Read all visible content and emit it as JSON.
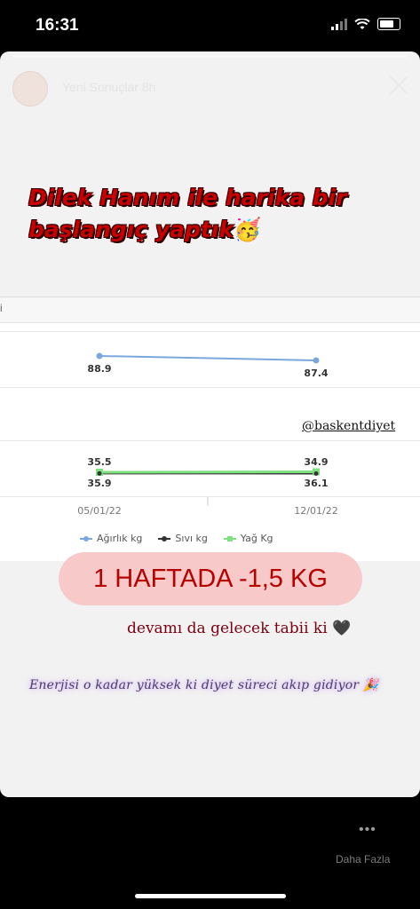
{
  "status_bar": {
    "time": "16:31"
  },
  "story": {
    "username": "Yeni Sonuçlar  8h",
    "headline_line1": "Dilek Hanım ile harika bir",
    "headline_line2": "başlangıç yaptık",
    "headline_emoji": "🥳",
    "instagram_handle": "@baskentdiyet",
    "result_text": "1 HAFTADA -1,5 KG",
    "continue_text": "devamı da gelecek tabii ki 🖤",
    "script_text": "Enerjisi o kadar yüksek ki diyet süreci akıp gidiyor 🎉",
    "more_label": "Daha Fazla",
    "more_icon": "ellipsis-icon"
  },
  "embedded_chart": {
    "header_text": "i",
    "legend": [
      "Ağırlık kg",
      "Sıvı kg",
      "Yağ Kg"
    ],
    "colors": {
      "weight": "#7aa8de",
      "fluid": "#333333",
      "fat": "#7ee07e"
    }
  },
  "chart_data": {
    "type": "line",
    "x": [
      "05/01/22",
      "12/01/22"
    ],
    "series": [
      {
        "name": "Ağırlık kg",
        "values": [
          88.9,
          87.4
        ]
      },
      {
        "name": "Sıvı kg",
        "values": [
          35.9,
          36.1
        ]
      },
      {
        "name": "Yağ Kg",
        "values": [
          35.5,
          34.9
        ]
      }
    ]
  }
}
